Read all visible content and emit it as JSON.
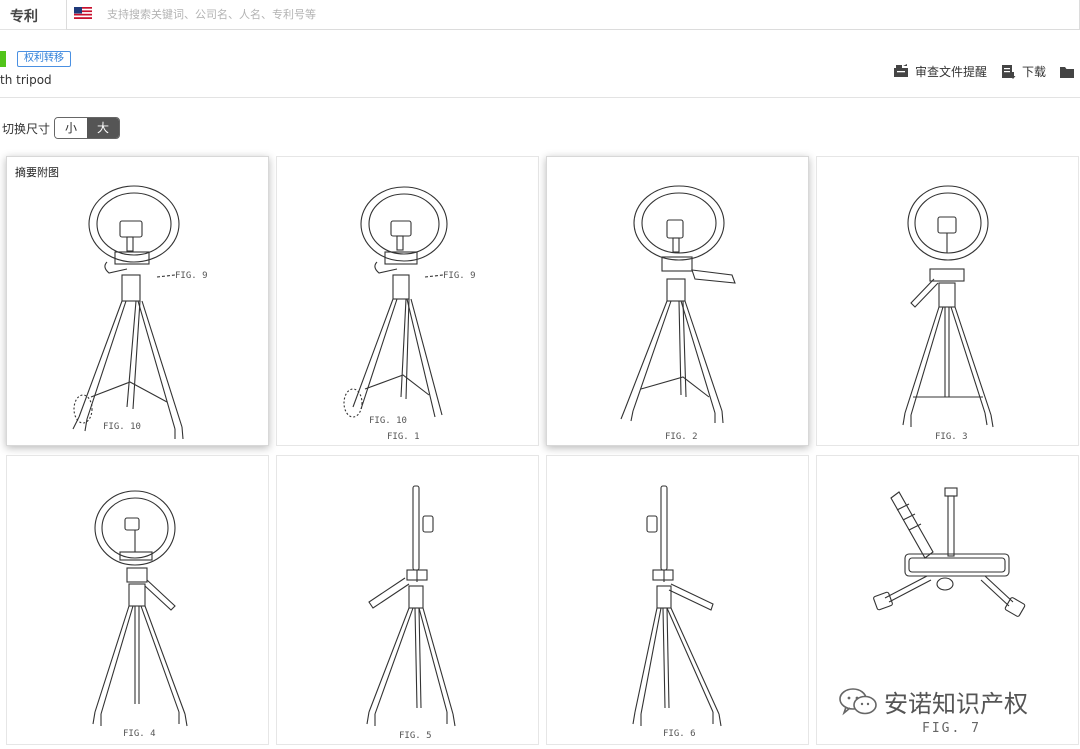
{
  "topbar": {
    "section_title": "专利",
    "search_placeholder": "支持搜索关键词、公司名、人名、专利号等",
    "flag_icon": "us-flag-icon"
  },
  "header": {
    "status_color": "#52c41a",
    "tag": "权利转移",
    "title_fragment": "th tripod",
    "actions": [
      {
        "label": "审查文件提醒",
        "icon": "review-file-alert-icon"
      },
      {
        "label": "下载",
        "icon": "download-icon"
      },
      {
        "label": "",
        "icon": "folder-icon"
      }
    ]
  },
  "switcher": {
    "label": "切换尺寸",
    "options": [
      "小",
      "大"
    ],
    "selected": "大"
  },
  "figures": [
    {
      "caption_label": "摘要附图",
      "fig_labels": [
        "FIG. 9",
        "FIG. 10"
      ],
      "view": "ring-light-front-angled"
    },
    {
      "caption_label": "",
      "fig_labels": [
        "FIG. 9",
        "FIG. 10",
        "FIG. 1"
      ],
      "view": "ring-light-front-angled"
    },
    {
      "caption_label": "",
      "fig_labels": [
        "FIG. 2"
      ],
      "view": "ring-light-rear-angled"
    },
    {
      "caption_label": "",
      "fig_labels": [
        "FIG. 3"
      ],
      "view": "ring-light-front"
    },
    {
      "caption_label": "",
      "fig_labels": [
        "FIG. 4"
      ],
      "view": "ring-light-rear"
    },
    {
      "caption_label": "",
      "fig_labels": [
        "FIG. 5"
      ],
      "view": "ring-light-left-side"
    },
    {
      "caption_label": "",
      "fig_labels": [
        "FIG. 6"
      ],
      "view": "ring-light-right-side"
    },
    {
      "caption_label": "",
      "fig_labels": [
        "FIG. 7"
      ],
      "view": "ring-light-bottom"
    }
  ],
  "watermark": {
    "icon": "wechat-icon",
    "text": "安诺知识产权"
  }
}
